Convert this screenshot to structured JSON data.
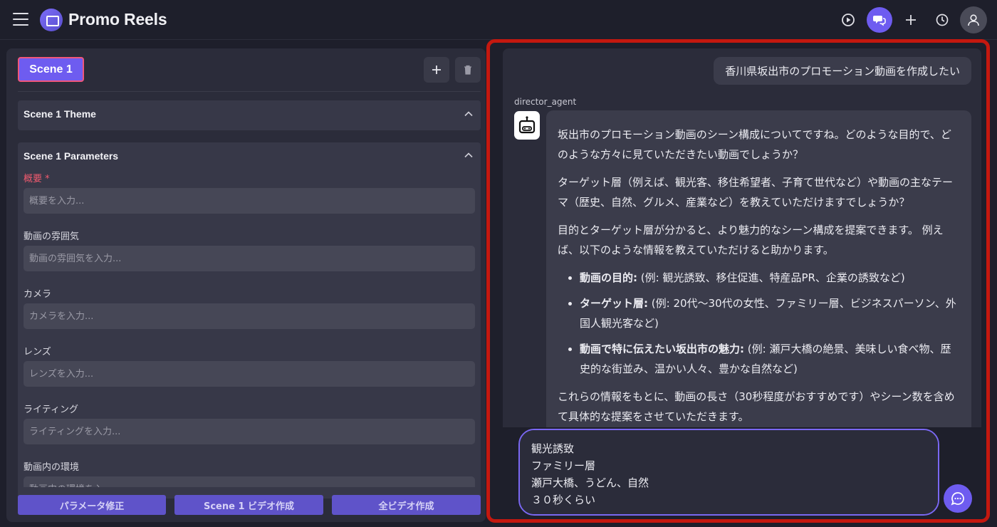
{
  "app": {
    "title": "Promo Reels"
  },
  "header_icons": [
    "menu-icon",
    "play-icon",
    "chat-icon",
    "plus-icon",
    "history-icon",
    "user-icon"
  ],
  "left": {
    "scene_tab": "Scene 1",
    "theme_section": "Scene 1 Theme",
    "params_section": "Scene 1 Parameters",
    "fields": [
      {
        "label": "概要 *",
        "placeholder": "概要を入力..."
      },
      {
        "label": "動画の雰囲気",
        "placeholder": "動画の雰囲気を入力..."
      },
      {
        "label": "カメラ",
        "placeholder": "カメラを入力..."
      },
      {
        "label": "レンズ",
        "placeholder": "レンズを入力..."
      },
      {
        "label": "ライティング",
        "placeholder": "ライティングを入力..."
      },
      {
        "label": "動画内の環境",
        "placeholder": "動画内の環境を入..."
      }
    ],
    "buttons": {
      "fix_params": "パラメータ修正",
      "make_scene_video": "Scene 1 ビデオ作成",
      "make_all_videos": "全ビデオ作成"
    }
  },
  "chat": {
    "user_message": "香川県坂出市のプロモーション動画を作成したい",
    "agent_name": "director_agent",
    "agent_paragraphs": [
      "坂出市のプロモーション動画のシーン構成についてですね。どのような目的で、どのような方々に見ていただきたい動画でしょうか？",
      "ターゲット層（例えば、観光客、移住希望者、子育て世代など）や動画の主なテーマ（歴史、自然、グルメ、産業など）を教えていただけますでしょうか？",
      "目的とターゲット層が分かると、より魅力的なシーン構成を提案できます。 例えば、以下のような情報を教えていただけると助かります。"
    ],
    "agent_bullets": [
      {
        "head": "動画の目的:",
        "body": " (例: 観光誘致、移住促進、特産品PR、企業の誘致など)"
      },
      {
        "head": "ターゲット層:",
        "body": " (例: 20代〜30代の女性、ファミリー層、ビジネスパーソン、外国人観光客など)"
      },
      {
        "head": "動画で特に伝えたい坂出市の魅力:",
        "body": " (例: 瀬戸大橋の絶景、美味しい食べ物、歴史的な街並み、温かい人々、豊かな自然など)"
      }
    ],
    "agent_closing": "これらの情報をもとに、動画の長さ（30秒程度がおすすめです）やシーン数を含めて具体的な提案をさせていただきます。",
    "input_value": "観光誘致\nファミリー層\n瀬戸大橋、うどん、自然\n３０秒くらい"
  },
  "colors": {
    "accent": "#6e5cf0",
    "highlight_border": "#c4180f",
    "required": "#ef5a6e",
    "panel": "#2b2c3a",
    "background": "#1e1f2b"
  }
}
